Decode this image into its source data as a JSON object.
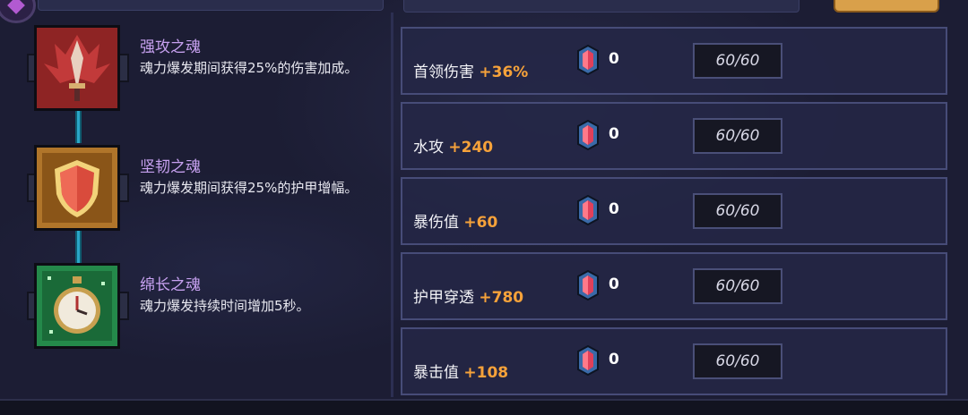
{
  "skills": [
    {
      "title": "强攻之魂",
      "desc": "魂力爆发期间获得25%的伤害加成。",
      "icon": "winged-sword-icon"
    },
    {
      "title": "坚韧之魂",
      "desc": "魂力爆发期间获得25%的护甲增幅。",
      "icon": "shield-icon"
    },
    {
      "title": "绵长之魂",
      "desc": "魂力爆发持续时间增加5秒。",
      "icon": "stopwatch-icon"
    }
  ],
  "stats": [
    {
      "name": "首领伤害",
      "bonus": "+36%",
      "count": "0",
      "cap": "60/60"
    },
    {
      "name": "水攻",
      "bonus": "+240",
      "count": "0",
      "cap": "60/60"
    },
    {
      "name": "暴伤值",
      "bonus": "+60",
      "count": "0",
      "cap": "60/60"
    },
    {
      "name": "护甲穿透",
      "bonus": "+780",
      "count": "0",
      "cap": "60/60"
    },
    {
      "name": "暴击值",
      "bonus": "+108",
      "count": "0",
      "cap": "60/60"
    }
  ],
  "colors": {
    "accent_orange": "#f6a23a",
    "skill_title": "#c7a1f0",
    "connector": "#2aa7c8"
  },
  "gem_icon": "soul-gem-icon"
}
